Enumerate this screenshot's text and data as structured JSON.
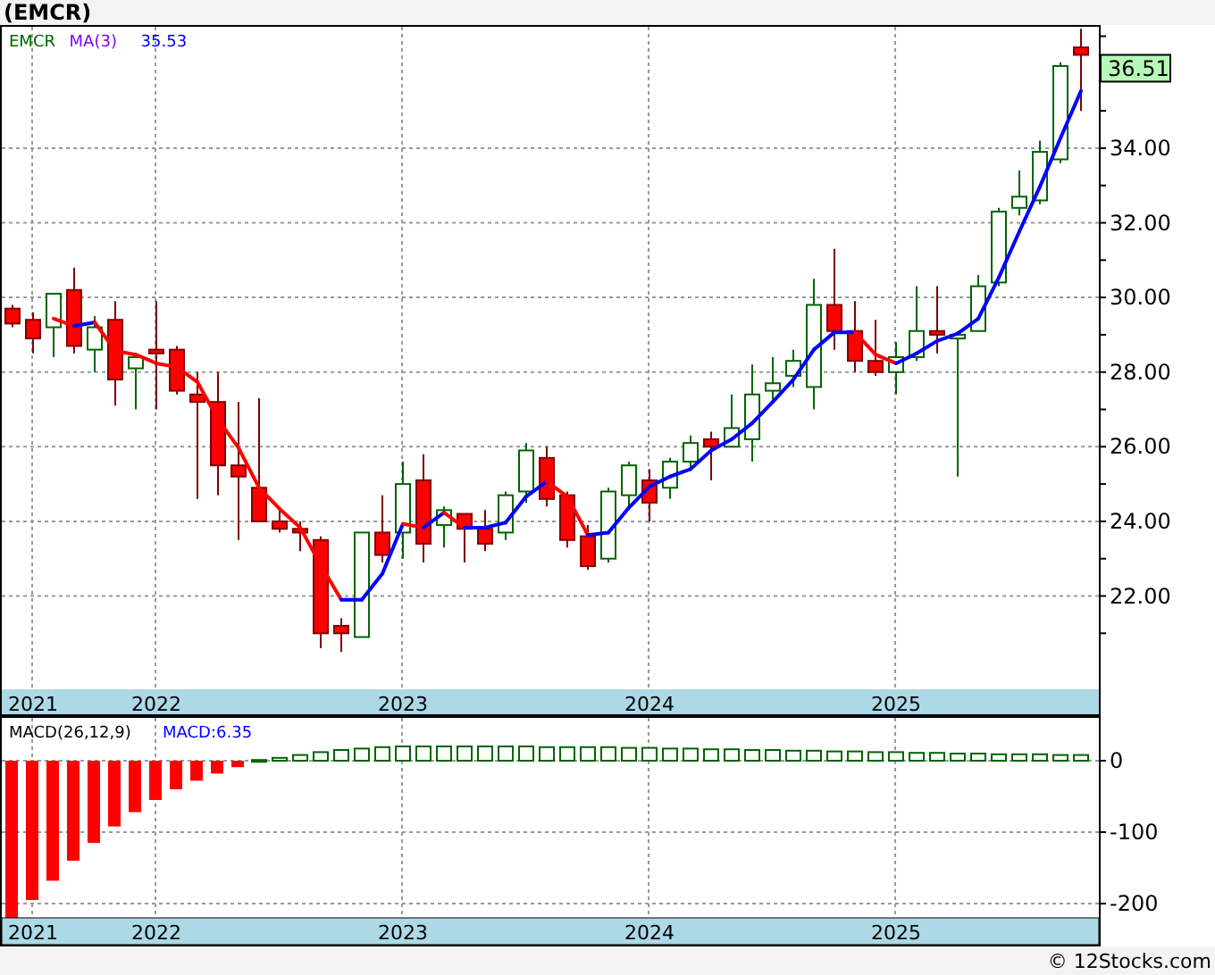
{
  "header": {
    "title": "(EMCR)"
  },
  "price_panel": {
    "legend": [
      {
        "label": "EMCR",
        "color": "#006400"
      },
      {
        "label": "MA(3)",
        "color": "#8000ff"
      },
      {
        "label": "35.53",
        "color": "#0000ff"
      }
    ],
    "last_price": "36.51",
    "chart_data": {
      "type": "candlestick",
      "ylim": [
        19.5,
        37.3
      ],
      "grid": true,
      "categories": [
        null,
        "2021",
        null,
        null,
        null,
        null,
        null,
        "2022",
        null,
        null,
        null,
        null,
        null,
        null,
        null,
        null,
        null,
        null,
        null,
        "2023",
        null,
        null,
        null,
        null,
        null,
        null,
        null,
        null,
        null,
        null,
        null,
        "2024",
        null,
        null,
        null,
        null,
        null,
        null,
        null,
        null,
        null,
        null,
        null,
        "2025",
        null,
        null,
        null,
        null,
        null,
        null,
        null,
        null,
        null
      ],
      "ohlc": [
        [
          29.7,
          29.8,
          29.2,
          29.3
        ],
        [
          29.4,
          29.6,
          28.5,
          28.9
        ],
        [
          29.2,
          30.1,
          28.4,
          30.1
        ],
        [
          30.2,
          30.8,
          28.5,
          28.7
        ],
        [
          28.6,
          29.5,
          28.0,
          29.2
        ],
        [
          29.4,
          29.9,
          27.1,
          27.8
        ],
        [
          28.1,
          28.5,
          27.0,
          28.4
        ],
        [
          28.6,
          29.9,
          27.0,
          28.5
        ],
        [
          28.6,
          28.7,
          27.4,
          27.5
        ],
        [
          27.4,
          28.0,
          24.6,
          27.2
        ],
        [
          27.2,
          28.0,
          24.7,
          25.5
        ],
        [
          25.5,
          27.2,
          23.5,
          25.2
        ],
        [
          24.9,
          27.3,
          24.0,
          24.0
        ],
        [
          24.0,
          24.3,
          23.7,
          23.8
        ],
        [
          23.8,
          24.0,
          23.2,
          23.7
        ],
        [
          23.5,
          23.6,
          20.6,
          21.0
        ],
        [
          21.2,
          21.4,
          20.5,
          21.0
        ],
        [
          20.9,
          23.7,
          20.9,
          23.7
        ],
        [
          23.7,
          24.7,
          22.9,
          23.1
        ],
        [
          23.7,
          25.6,
          23.0,
          25.0
        ],
        [
          25.1,
          25.8,
          22.9,
          23.4
        ],
        [
          23.9,
          24.4,
          23.3,
          24.3
        ],
        [
          24.2,
          24.2,
          22.9,
          23.8
        ],
        [
          23.8,
          24.3,
          23.2,
          23.4
        ],
        [
          23.7,
          24.8,
          23.5,
          24.7
        ],
        [
          24.8,
          26.1,
          24.5,
          25.9
        ],
        [
          25.7,
          26.0,
          24.4,
          24.6
        ],
        [
          24.7,
          24.8,
          23.3,
          23.5
        ],
        [
          23.6,
          23.9,
          22.7,
          22.8
        ],
        [
          23.0,
          24.9,
          22.9,
          24.8
        ],
        [
          24.7,
          25.6,
          24.3,
          25.5
        ],
        [
          25.1,
          25.4,
          24.0,
          24.5
        ],
        [
          24.9,
          25.7,
          24.6,
          25.6
        ],
        [
          25.6,
          26.3,
          25.4,
          26.1
        ],
        [
          26.2,
          26.4,
          25.1,
          26.0
        ],
        [
          26.0,
          27.4,
          26.0,
          26.5
        ],
        [
          26.2,
          28.2,
          25.6,
          27.4
        ],
        [
          27.5,
          28.4,
          27.2,
          27.7
        ],
        [
          27.9,
          28.6,
          27.6,
          28.3
        ],
        [
          27.6,
          30.5,
          27.0,
          29.8
        ],
        [
          29.8,
          31.3,
          28.6,
          29.1
        ],
        [
          29.1,
          29.9,
          28.0,
          28.3
        ],
        [
          28.3,
          29.4,
          27.9,
          28.0
        ],
        [
          28.0,
          28.8,
          27.4,
          28.4
        ],
        [
          28.4,
          30.3,
          28.3,
          29.1
        ],
        [
          29.1,
          30.3,
          28.5,
          29.0
        ],
        [
          28.9,
          29.1,
          25.2,
          29.0
        ],
        [
          29.1,
          30.6,
          29.1,
          30.3
        ],
        [
          30.4,
          32.4,
          30.3,
          32.3
        ],
        [
          32.4,
          33.4,
          32.2,
          32.7
        ],
        [
          32.6,
          34.2,
          32.5,
          33.9
        ],
        [
          33.7,
          36.3,
          33.6,
          36.2
        ],
        [
          36.7,
          37.2,
          35.0,
          36.5
        ]
      ],
      "yticks": [
        {
          "value": 22,
          "label": "22.00"
        },
        {
          "value": 24,
          "label": "24.00"
        },
        {
          "value": 26,
          "label": "26.00"
        },
        {
          "value": 28,
          "label": "28.00"
        },
        {
          "value": 30,
          "label": "30.00"
        },
        {
          "value": 32,
          "label": "32.00"
        },
        {
          "value": 34,
          "label": "34.00"
        }
      ]
    }
  },
  "macd_panel": {
    "legend": [
      {
        "label": "MACD(26,12,9)",
        "color": "#000000"
      },
      {
        "label": "MACD:6.35",
        "color": "#0000ff"
      }
    ],
    "chart_data": {
      "type": "bar",
      "ylim": [
        -220,
        60
      ],
      "grid": true,
      "categories": [
        null,
        "2021",
        null,
        null,
        null,
        null,
        null,
        "2022",
        null,
        null,
        null,
        null,
        null,
        null,
        null,
        null,
        null,
        null,
        null,
        "2023",
        null,
        null,
        null,
        null,
        null,
        null,
        null,
        null,
        null,
        null,
        null,
        "2024",
        null,
        null,
        null,
        null,
        null,
        null,
        null,
        null,
        null,
        null,
        null,
        "2025",
        null,
        null,
        null,
        null,
        null,
        null,
        null,
        null,
        null
      ],
      "values": [
        -220,
        -195,
        -168,
        -140,
        -115,
        -92,
        -72,
        -55,
        -40,
        -28,
        -18,
        -9,
        1,
        4,
        8,
        12,
        15,
        17,
        19,
        20,
        20,
        20,
        20,
        20,
        20,
        20,
        19,
        19,
        19,
        19,
        18,
        18,
        17,
        17,
        16,
        16,
        15,
        15,
        14,
        14,
        13,
        13,
        12,
        12,
        11,
        11,
        10,
        10,
        9,
        9,
        9,
        8,
        8
      ],
      "yticks": [
        {
          "value": 0,
          "label": "0"
        },
        {
          "value": -100,
          "label": "-100"
        },
        {
          "value": -200,
          "label": "-200"
        }
      ]
    }
  },
  "footer": "© 12Stocks.com"
}
